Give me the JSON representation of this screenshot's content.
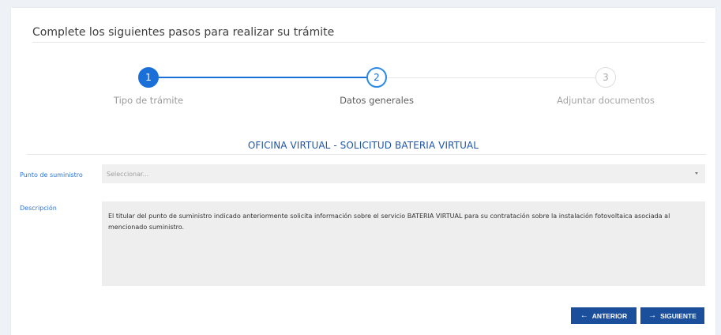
{
  "card": {
    "title": "Complete los siguientes pasos para realizar su trámite"
  },
  "stepper": {
    "steps": [
      {
        "number": "1",
        "label": "Tipo de trámite",
        "state": "completed"
      },
      {
        "number": "2",
        "label": "Datos generales",
        "state": "active"
      },
      {
        "number": "3",
        "label": "Adjuntar documentos",
        "state": "pending"
      }
    ]
  },
  "form": {
    "section_title": "OFICINA VIRTUAL - SOLICITUD BATERIA VIRTUAL",
    "supply_point": {
      "label": "Punto de suministro",
      "placeholder": "Seleccionar..."
    },
    "description": {
      "label": "Descripción",
      "value": "El titular del punto de suministro indicado anteriormente solicita información sobre el servicio BATERIA VIRTUAL para su contratación sobre la instalación fotovoltaica asociada al mencionado suministro."
    }
  },
  "actions": {
    "prev_label": "ANTERIOR",
    "prev_icon": "arrow-left-icon",
    "next_label": "SIGUIENTE",
    "next_icon": "arrow-right-icon"
  },
  "colors": {
    "accent": "#1b6fd8",
    "button": "#1b4f9c",
    "section_title": "#1f56a8"
  }
}
